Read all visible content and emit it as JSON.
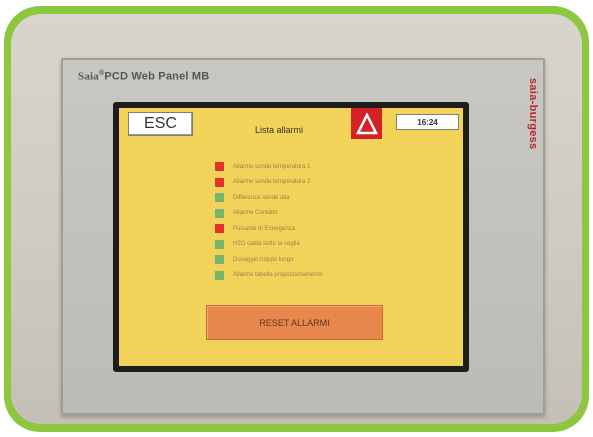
{
  "device": {
    "brand_prefix": "Saia",
    "brand_mark": "®",
    "brand_name": "PCD Web Panel MB",
    "side_brand": "saia-burgess"
  },
  "screen": {
    "esc_label": "ESC",
    "title": "Lista allarmi",
    "clock": "16:24",
    "alarm_icon": "warning-triangle-icon",
    "alarms": [
      {
        "label": "Allarme sonda temperatura 1",
        "state": "red"
      },
      {
        "label": "Allarme sonda temperatura 2",
        "state": "red"
      },
      {
        "label": "Differenza sonde alta",
        "state": "green"
      },
      {
        "label": "Allarme Contatto",
        "state": "green"
      },
      {
        "label": "Pulsante di Emergenza",
        "state": "red"
      },
      {
        "label": "H2O calda sotto la soglia",
        "state": "green"
      },
      {
        "label": "Dosaggio troppo lungo",
        "state": "green"
      },
      {
        "label": "Allarme tabella proporzionamento",
        "state": "green"
      }
    ],
    "reset_label": "RESET ALLARMI"
  },
  "colors": {
    "frame_green": "#8dc63f",
    "screen_yellow": "#f2d35a",
    "alarm_red": "#e0332c",
    "ok_green": "#77b56a",
    "reset_orange": "#e8874c"
  }
}
